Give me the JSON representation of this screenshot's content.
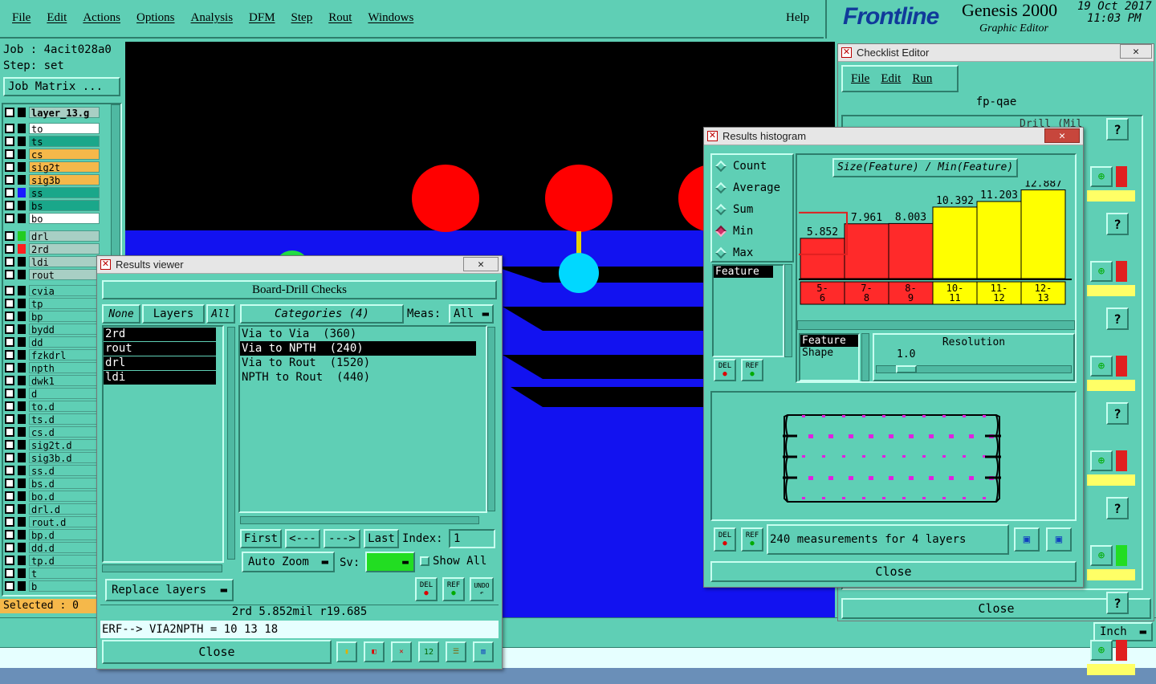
{
  "menubar": {
    "items": [
      "File",
      "Edit",
      "Actions",
      "Options",
      "Analysis",
      "DFM",
      "Step",
      "Rout",
      "Windows"
    ],
    "help": "Help"
  },
  "brand": {
    "logo": "Frontline",
    "product": "Genesis 2000",
    "subtitle": "Graphic Editor",
    "date": "19 Oct 2017",
    "time": "11:03 PM"
  },
  "job": {
    "job_label": "Job : 4acit028a0",
    "step_label": "Step: set",
    "matrix_button": "Job Matrix ..."
  },
  "layers": {
    "top": "layer_13.g",
    "group1": [
      {
        "name": "to",
        "color": "#ffffff"
      },
      {
        "name": "ts",
        "color": "#1aa78a"
      },
      {
        "name": "cs",
        "color": "#f5b84a"
      },
      {
        "name": "sig2t",
        "color": "#f5b84a"
      },
      {
        "name": "sig3b",
        "color": "#f5b84a"
      },
      {
        "name": "ss",
        "color": "#1aa78a",
        "swatch": "#1a1aff"
      },
      {
        "name": "bs",
        "color": "#1aa78a"
      },
      {
        "name": "bo",
        "color": "#ffffff"
      }
    ],
    "group2": [
      {
        "name": "drl",
        "color": "#a8cfc4",
        "swatch": "#22cc22"
      },
      {
        "name": "2rd",
        "color": "#a8cfc4",
        "swatch": "#ff2020"
      },
      {
        "name": "ldi",
        "color": "#a8cfc4"
      },
      {
        "name": "rout",
        "color": "#a8cfc4"
      }
    ],
    "group3": [
      "cvia",
      "tp",
      "bp",
      "bydd",
      "dd",
      "fzkdrl",
      "npth",
      "dwk1",
      "d",
      "to.d",
      "ts.d",
      "cs.d",
      "sig2t.d",
      "sig3b.d",
      "ss.d",
      "bs.d",
      "bo.d",
      "drl.d",
      "rout.d",
      "bp.d",
      "dd.d",
      "tp.d",
      "t",
      "b"
    ],
    "selected": "Selected : 0"
  },
  "results_viewer": {
    "title": "Results viewer",
    "header": "Board-Drill Checks",
    "none_btn": "None",
    "layers_btn": "Layers",
    "all_btn": "All",
    "categories_btn": "Categories (4)",
    "meas_label": "Meas:",
    "meas_value": "All",
    "layer_list": [
      "2rd",
      "rout",
      "drl",
      "ldi"
    ],
    "categories": [
      "Via to Via  (360)",
      "Via to NPTH  (240)",
      "Via to Rout  (1520)",
      "NPTH to Rout  (440)"
    ],
    "selected_category": 1,
    "first": "First",
    "prev": "<---",
    "next": "--->",
    "last": "Last",
    "index_label": "Index:",
    "index_value": "1",
    "auto_zoom": "Auto Zoom",
    "sv_label": "Sv:",
    "show_all": "Show All",
    "replace_layers": "Replace layers",
    "del": "DEL",
    "ref": "REF",
    "undo": "UNDO",
    "status": "2rd 5.852mil  r19.685",
    "erf": "ERF--> VIA2NPTH = 10 13 18",
    "close": "Close"
  },
  "histogram": {
    "title": "Results histogram",
    "modes": [
      "Count",
      "Average",
      "Sum",
      "Min",
      "Max"
    ],
    "active_mode": "Min",
    "feature_label": "Feature",
    "chart_title": "Size(Feature) / Min(Feature)",
    "bins": [
      "5-\n6",
      "7-\n8",
      "8-\n9",
      "10-\n11",
      "11-\n12",
      "12-\n13"
    ],
    "values": [
      5.852,
      7.961,
      8.003,
      10.392,
      11.203,
      12.887
    ],
    "value_labels": [
      "5.852",
      "7.961",
      "8.003",
      "10.392",
      "11.203",
      "12.887"
    ],
    "bar_colors": [
      "#ff2a2a",
      "#ff2a2a",
      "#ff2a2a",
      "#ffff00",
      "#ffff00",
      "#ffff00"
    ],
    "resolution_label": "Resolution",
    "resolution_value": "1.0",
    "list_items": [
      "Feature",
      "Shape"
    ],
    "measurements": "240 measurements for 4 layers",
    "close": "Close",
    "del": "DEL",
    "ref": "REF"
  },
  "checklist": {
    "title": "Checklist Editor",
    "menus": [
      "File",
      "Edit",
      "Run"
    ],
    "name": "fp-qae",
    "row_text": "Drill (Mil",
    "close": "Close"
  },
  "bottom": {
    "unit": "Inch"
  }
}
